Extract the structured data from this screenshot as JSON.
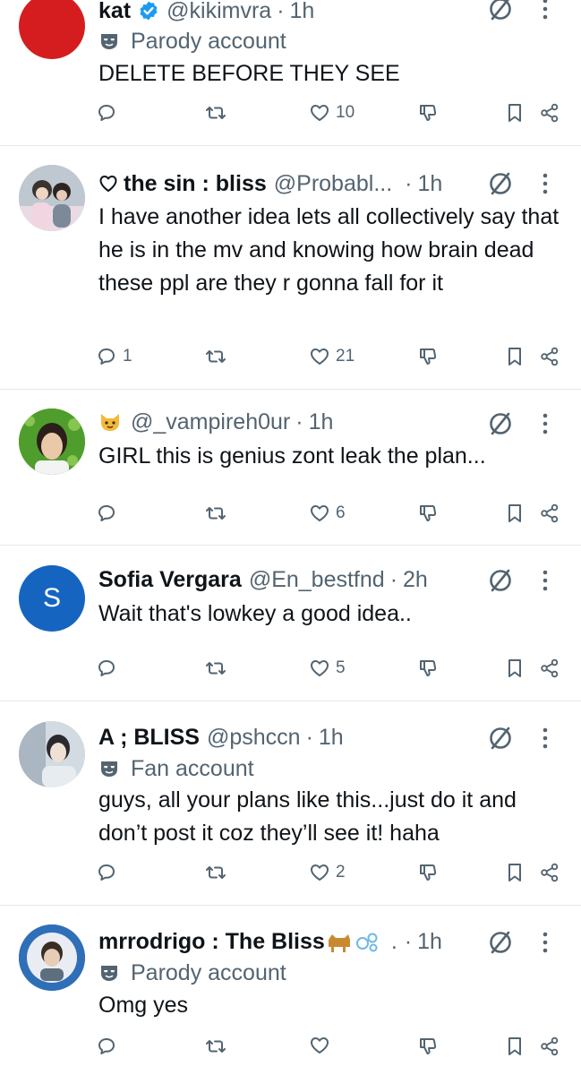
{
  "tweets": [
    {
      "avatar": {
        "type": "color",
        "color": "#d51d1f"
      },
      "name": "kat",
      "verified": true,
      "handle": "@kikimvra",
      "separator": "·",
      "time": "1h",
      "label": "Parody account",
      "text": "DELETE BEFORE THEY SEE",
      "counts": {
        "reply": "",
        "retweet": "",
        "like": "10"
      }
    },
    {
      "avatar": {
        "type": "photo",
        "colors": [
          "#9aa8b2",
          "#e4d7df"
        ]
      },
      "name": "the sin : bliss",
      "name_prefix": "heart-outline",
      "handle": "@Probabl...",
      "separator": "·",
      "time": "1h",
      "text": "I have another idea lets all collectively say that he is in the mv and knowing how brain dead these ppl are they r gonna fall for it",
      "counts": {
        "reply": "1",
        "retweet": "",
        "like": "21"
      }
    },
    {
      "avatar": {
        "type": "photo",
        "colors": [
          "#4f9e2d",
          "#e7c6a8"
        ]
      },
      "name_prefix": "cat-emoji",
      "name": "",
      "handle": "@_vampireh0ur",
      "separator": "·",
      "time": "1h",
      "text": "GIRL this is genius zont leak the plan...",
      "counts": {
        "reply": "",
        "retweet": "",
        "like": "6"
      }
    },
    {
      "avatar": {
        "type": "initial",
        "letter": "S",
        "color": "#1565c0"
      },
      "name": "Sofia Vergara",
      "handle": "@En_bestfnd",
      "separator": "·",
      "time": "2h",
      "text": "Wait that's lowkey a good idea..",
      "counts": {
        "reply": "",
        "retweet": "",
        "like": "5"
      }
    },
    {
      "avatar": {
        "type": "photo",
        "colors": [
          "#c9d1d8",
          "#8e9aa6"
        ]
      },
      "name": "A ; BLISS",
      "handle": "@pshccn",
      "separator": "·",
      "time": "1h",
      "label": "Fan account",
      "text": "guys, all your plans like this...just do it and don’t post it coz they’ll see it! haha",
      "counts": {
        "reply": "",
        "retweet": "",
        "like": "2"
      }
    },
    {
      "avatar": {
        "type": "photo",
        "colors": [
          "#2f6fb7",
          "#d8cbb8"
        ]
      },
      "name": "mrrodrigo : The Bliss",
      "name_suffix": "dog-bubbles-emoji",
      "handle": ".",
      "separator": "·",
      "time": "1h",
      "label": "Parody account",
      "text": "Omg yes",
      "counts": {
        "reply": "",
        "retweet": "",
        "like": ""
      }
    }
  ],
  "icons": {
    "reply": "reply-bubble-icon",
    "retweet": "retweet-icon",
    "like": "heart-icon",
    "views": "thumbs-down-icon",
    "bookmark": "bookmark-icon",
    "share": "share-icon",
    "grok": "grok-slash-circle-icon",
    "more": "more-vertical-icon",
    "label": "masked-face-icon"
  },
  "colors": {
    "text": "#0f1419",
    "muted": "#536471",
    "divider": "#e3e7ea",
    "verified": "#1d9bf0"
  }
}
